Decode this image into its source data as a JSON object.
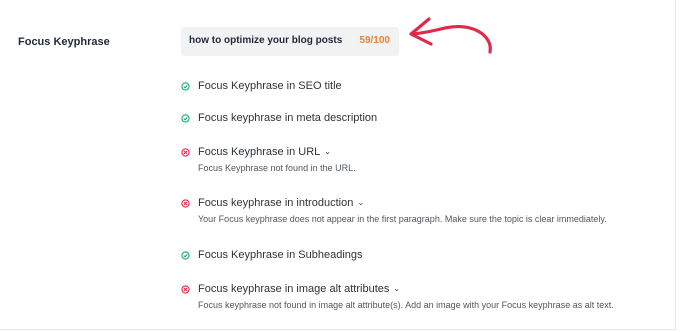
{
  "field": {
    "label": "Focus Keyphrase",
    "keyphrase": "how to optimize your blog posts",
    "score": "59/100"
  },
  "colors": {
    "pass": "#1ea672",
    "fail": "#df2a4a",
    "score": "#e7833a",
    "arrow": "#df2a4a"
  },
  "checks": [
    {
      "title": "Focus Keyphrase in SEO title",
      "status": "pass",
      "expandable": false,
      "message": ""
    },
    {
      "title": "Focus keyphrase in meta description",
      "status": "pass",
      "expandable": false,
      "message": ""
    },
    {
      "title": "Focus Keyphrase in URL",
      "status": "fail",
      "expandable": true,
      "message": "Focus Keyphrase not found in the URL."
    },
    {
      "title": "Focus keyphrase in introduction",
      "status": "fail",
      "expandable": true,
      "message": "Your Focus keyphrase does not appear in the first paragraph. Make sure the topic is clear immediately."
    },
    {
      "title": "Focus Keyphrase in Subheadings",
      "status": "pass",
      "expandable": false,
      "message": ""
    },
    {
      "title": "Focus keyphrase in image alt attributes",
      "status": "fail",
      "expandable": true,
      "message": "Focus keyphrase not found in image alt attribute(s). Add an image with your Focus keyphrase as alt text."
    }
  ]
}
